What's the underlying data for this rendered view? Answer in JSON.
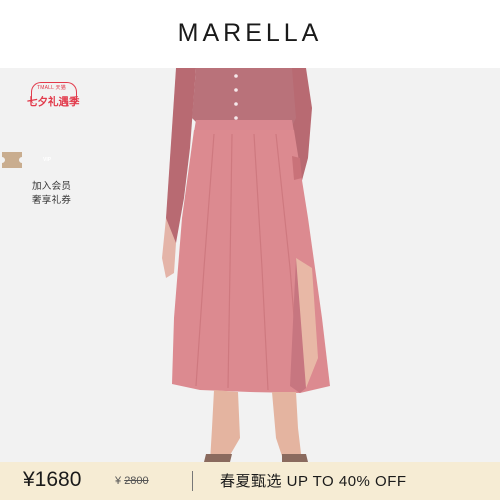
{
  "header": {
    "brand": "MARELLA"
  },
  "badges": {
    "festival_small": "TMALL 天猫",
    "festival_main": "七夕礼遇季",
    "vip_label": "VIP",
    "member_line1": "加入会员",
    "member_line2": "奢享礼券"
  },
  "price_bar": {
    "price": "¥1680",
    "old_price_symbol": "¥",
    "old_price": "2800",
    "promo": "春夏甄选  UP TO 40% OFF"
  },
  "colors": {
    "skirt": "#dc8a90",
    "top": "#b86a72",
    "festival_red": "#e23a4b",
    "price_bar_bg": "#f6ecd4"
  }
}
